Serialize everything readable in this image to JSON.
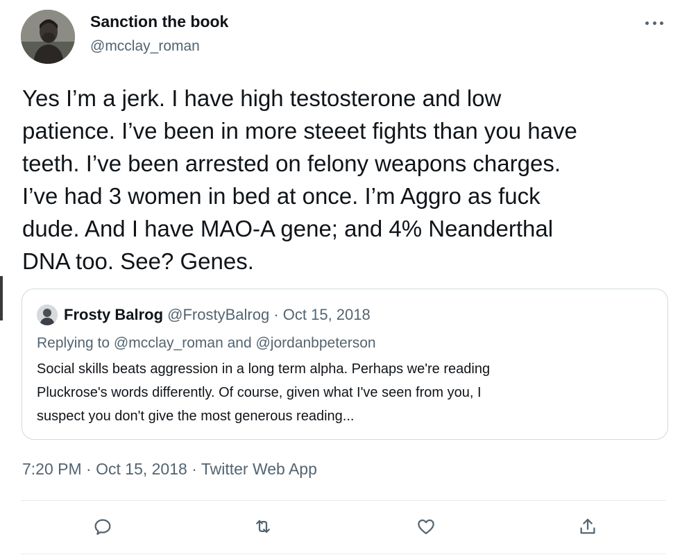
{
  "author": {
    "display_name": "Sanction the book",
    "handle": "@mcclay_roman",
    "avatar_icon": "profile-photo-icon"
  },
  "tweet": {
    "text": "Yes I’m a jerk. I have high testosterone and low\npatience. I’ve been in more steeet fights than you have\nteeth. I’ve been arrested on felony weapons charges.\nI’ve had 3 women in bed at once. I’m Aggro as fuck\ndude. And I have MAO-A gene; and 4% Neanderthal\nDNA too. See? Genes."
  },
  "quote": {
    "display_name": "Frosty Balrog",
    "handle": "@FrostyBalrog",
    "separator": " · ",
    "date": "Oct 15, 2018",
    "replying_prefix": "Replying to ",
    "replying_to_1": "@mcclay_roman",
    "replying_and": " and ",
    "replying_to_2": "@jordanbpeterson",
    "text": "Social skills beats aggression in a long term alpha. Perhaps we're reading\nPluckrose's words differently. Of course, given what I've seen from you,  I\nsuspect you don't give the most generous reading..."
  },
  "meta": {
    "time": "7:20 PM",
    "separator": " · ",
    "date": "Oct 15, 2018",
    "source": "Twitter Web App"
  },
  "actions": [
    {
      "name": "reply-icon"
    },
    {
      "name": "retweet-icon"
    },
    {
      "name": "like-icon"
    },
    {
      "name": "share-icon"
    }
  ],
  "colors": {
    "text_primary": "#0f1419",
    "text_secondary": "#536471",
    "border": "#cfd9de"
  }
}
